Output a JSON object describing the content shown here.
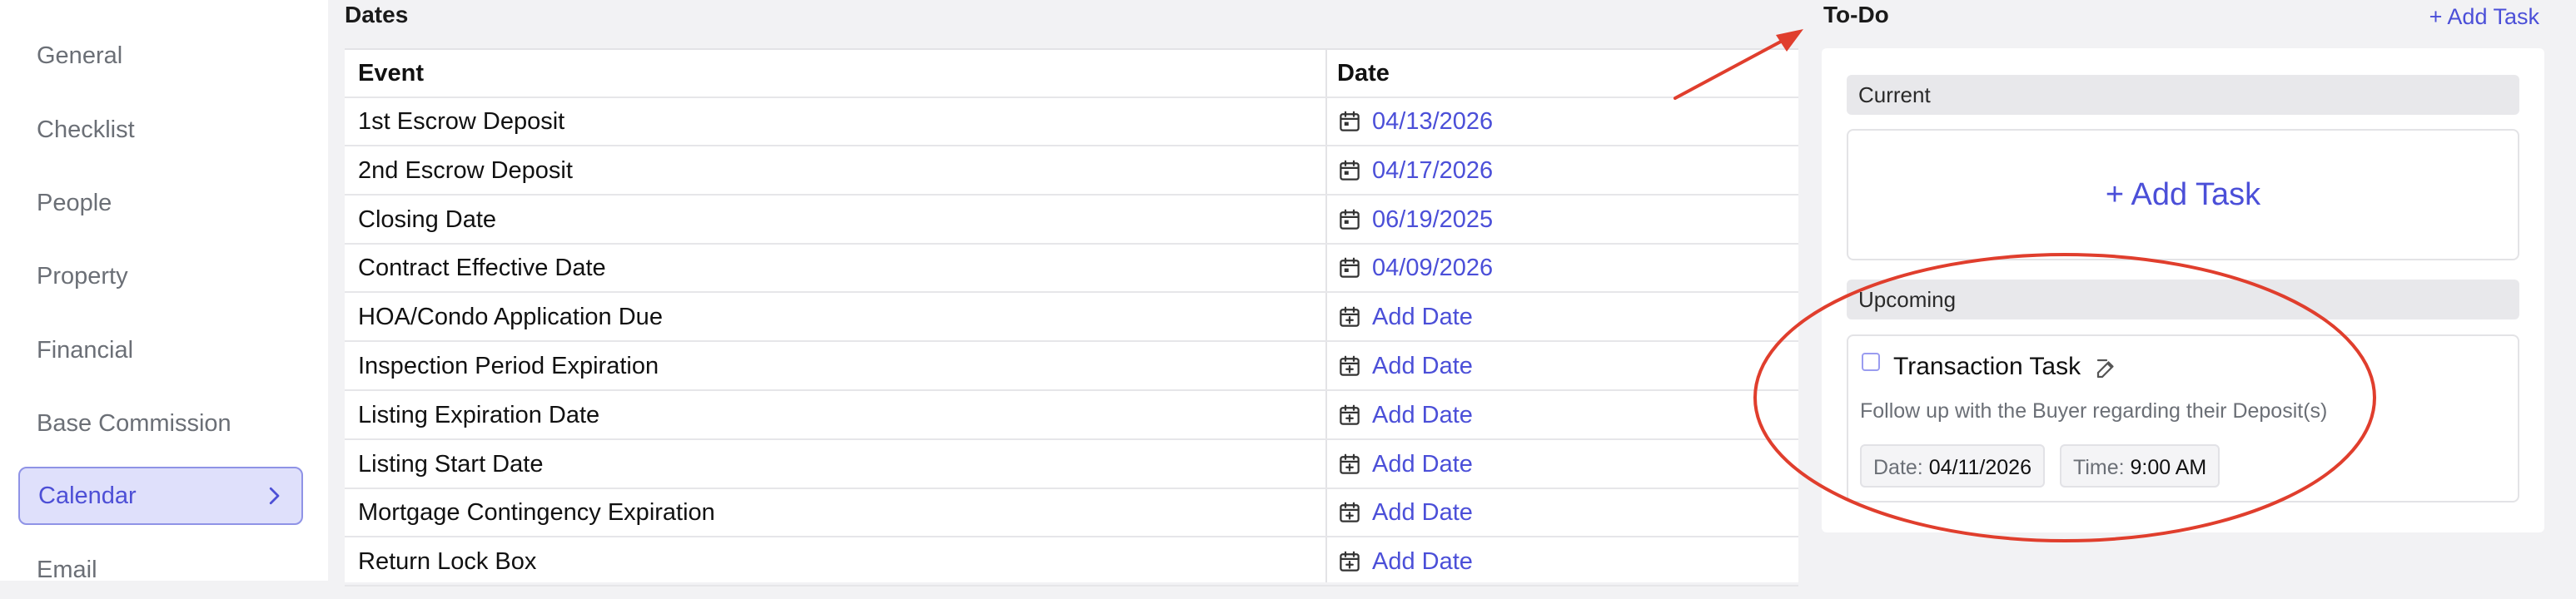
{
  "sidebar": {
    "items": [
      {
        "label": "General",
        "active": false
      },
      {
        "label": "Checklist",
        "active": false
      },
      {
        "label": "People",
        "active": false
      },
      {
        "label": "Property",
        "active": false
      },
      {
        "label": "Financial",
        "active": false
      },
      {
        "label": "Base Commission",
        "active": false
      },
      {
        "label": "Calendar",
        "active": true
      },
      {
        "label": "Email",
        "active": false
      }
    ]
  },
  "dates": {
    "title": "Dates",
    "columns": [
      "Event",
      "Date"
    ],
    "rows": [
      {
        "event": "1st Escrow Deposit",
        "date": "04/13/2026",
        "has_date": true
      },
      {
        "event": "2nd Escrow Deposit",
        "date": "04/17/2026",
        "has_date": true
      },
      {
        "event": "Closing Date",
        "date": "06/19/2025",
        "has_date": true
      },
      {
        "event": "Contract Effective Date",
        "date": "04/09/2026",
        "has_date": true
      },
      {
        "event": "HOA/Condo Application Due",
        "date": "Add Date",
        "has_date": false
      },
      {
        "event": "Inspection Period Expiration",
        "date": "Add Date",
        "has_date": false
      },
      {
        "event": "Listing Expiration Date",
        "date": "Add Date",
        "has_date": false
      },
      {
        "event": "Listing Start Date",
        "date": "Add Date",
        "has_date": false
      },
      {
        "event": "Mortgage Contingency Expiration",
        "date": "Add Date",
        "has_date": false
      },
      {
        "event": "Return Lock Box",
        "date": "Add Date",
        "has_date": false
      }
    ]
  },
  "todo": {
    "title": "To-Do",
    "add_task_label": "+ Add Task",
    "current": {
      "header": "Current",
      "add_task_label": "+ Add Task"
    },
    "upcoming": {
      "header": "Upcoming",
      "task": {
        "title": "Transaction Task",
        "description": "Follow up with the Buyer regarding their Deposit(s)",
        "date_label": "Date:",
        "date_value": "04/11/2026",
        "time_label": "Time:",
        "time_value": "9:00 AM"
      }
    }
  },
  "colors": {
    "accent": "#4b4fd8",
    "active_bg": "#dfe0fb",
    "annotation": "#e03e2d"
  }
}
